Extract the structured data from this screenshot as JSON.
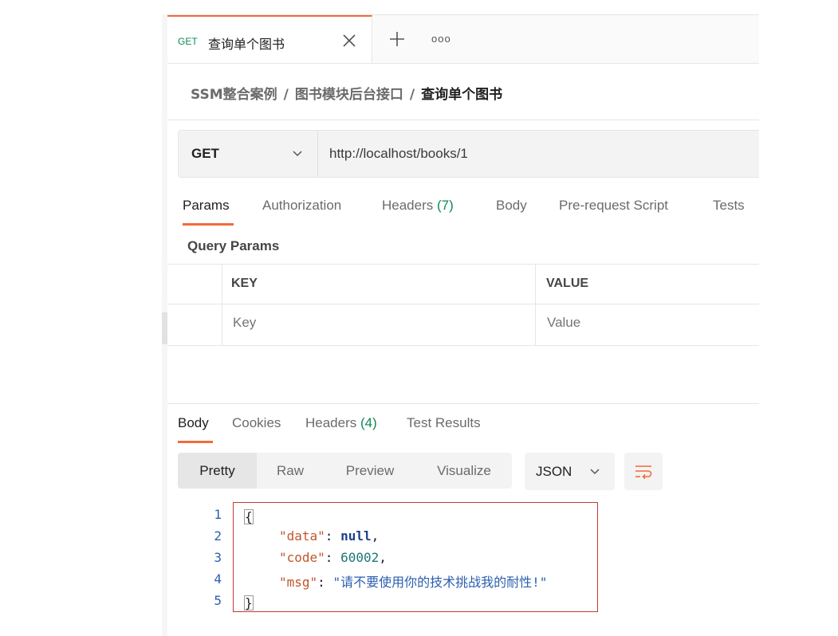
{
  "tab": {
    "method": "GET",
    "title": "查询单个图书",
    "more_label": "ooo",
    "colors": {
      "accent": "#f26b3a",
      "method_green": "#0b8a55"
    }
  },
  "breadcrumb": {
    "items": [
      "SSM整合案例",
      "图书模块后台接口",
      "查询单个图书"
    ],
    "separator": "/"
  },
  "request": {
    "method": "GET",
    "url": "http://localhost/books/1"
  },
  "request_tabs": {
    "items": [
      {
        "label": "Params",
        "count": ""
      },
      {
        "label": "Authorization",
        "count": ""
      },
      {
        "label": "Headers",
        "count": "(7)"
      },
      {
        "label": "Body",
        "count": ""
      },
      {
        "label": "Pre-request Script",
        "count": ""
      },
      {
        "label": "Tests",
        "count": ""
      }
    ],
    "active": "Params"
  },
  "query_params": {
    "title": "Query Params",
    "headers": [
      "KEY",
      "VALUE"
    ],
    "key_placeholder": "Key",
    "value_placeholder": "Value"
  },
  "response_tabs": {
    "items": [
      {
        "label": "Body",
        "count": ""
      },
      {
        "label": "Cookies",
        "count": ""
      },
      {
        "label": "Headers",
        "count": "(4)"
      },
      {
        "label": "Test Results",
        "count": ""
      }
    ],
    "active": "Body"
  },
  "view_modes": {
    "items": [
      "Pretty",
      "Raw",
      "Preview",
      "Visualize"
    ],
    "active": "Pretty",
    "format": "JSON"
  },
  "response_body": {
    "line_numbers": [
      "1",
      "2",
      "3",
      "4",
      "5"
    ],
    "open_brace": "{",
    "close_brace": "}",
    "fields": [
      {
        "key": "\"data\"",
        "value": "null",
        "type": "null",
        "trailing": ","
      },
      {
        "key": "\"code\"",
        "value": "60002",
        "type": "number",
        "trailing": ","
      },
      {
        "key": "\"msg\"",
        "value": "\"请不要使用你的技术挑战我的耐性!\"",
        "type": "string",
        "trailing": ""
      }
    ],
    "colon": ": ",
    "highlight_color": "#c23a34"
  },
  "icons": [
    "close-icon",
    "plus-icon",
    "more-icon",
    "chevron-down-icon",
    "wrap-lines-icon"
  ]
}
